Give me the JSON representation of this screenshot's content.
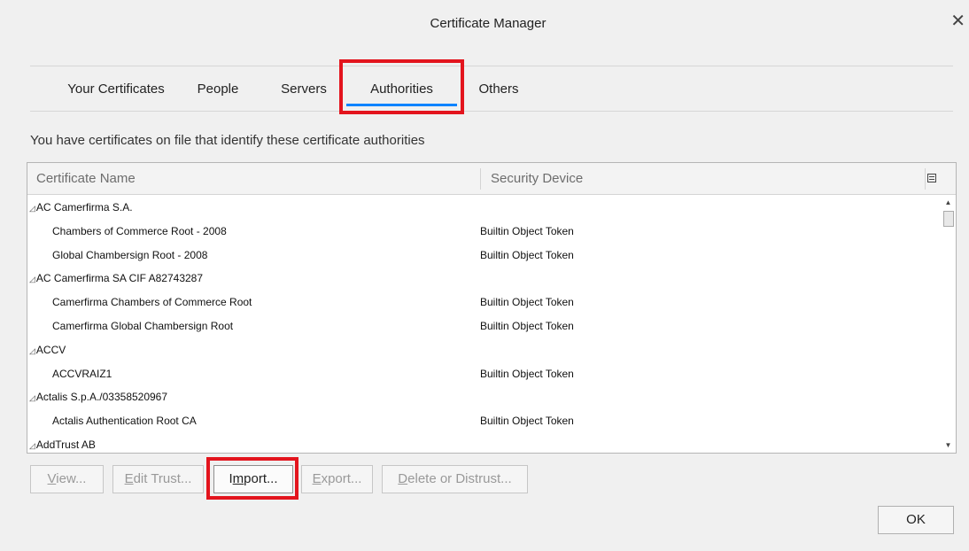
{
  "dialog": {
    "title": "Certificate Manager"
  },
  "tabs": [
    {
      "label": "Your Certificates",
      "selected": false
    },
    {
      "label": "People",
      "selected": false
    },
    {
      "label": "Servers",
      "selected": false
    },
    {
      "label": "Authorities",
      "selected": true
    },
    {
      "label": "Others",
      "selected": false
    }
  ],
  "description": "You have certificates on file that identify these certificate authorities",
  "table": {
    "columns": [
      "Certificate Name",
      "Security Device"
    ],
    "rows": [
      {
        "type": "group",
        "name": "AC Camerfirma S.A.",
        "device": ""
      },
      {
        "type": "child",
        "name": "Chambers of Commerce Root - 2008",
        "device": "Builtin Object Token"
      },
      {
        "type": "child",
        "name": "Global Chambersign Root - 2008",
        "device": "Builtin Object Token"
      },
      {
        "type": "group",
        "name": "AC Camerfirma SA CIF A82743287",
        "device": ""
      },
      {
        "type": "child",
        "name": "Camerfirma Chambers of Commerce Root",
        "device": "Builtin Object Token"
      },
      {
        "type": "child",
        "name": "Camerfirma Global Chambersign Root",
        "device": "Builtin Object Token"
      },
      {
        "type": "group",
        "name": "ACCV",
        "device": ""
      },
      {
        "type": "child",
        "name": "ACCVRAIZ1",
        "device": "Builtin Object Token"
      },
      {
        "type": "group",
        "name": "Actalis S.p.A./03358520967",
        "device": ""
      },
      {
        "type": "child",
        "name": "Actalis Authentication Root CA",
        "device": "Builtin Object Token"
      },
      {
        "type": "group",
        "name": "AddTrust AB",
        "device": ""
      }
    ]
  },
  "buttons": {
    "view": {
      "pre": "",
      "key": "V",
      "post": "iew..."
    },
    "edit_trust": {
      "pre": "",
      "key": "E",
      "post": "dit Trust..."
    },
    "import": {
      "pre": "I",
      "key": "m",
      "post": "port..."
    },
    "export": {
      "pre": "",
      "key": "E",
      "post": "xport..."
    },
    "delete": {
      "pre": "",
      "key": "D",
      "post": "elete or Distrust..."
    },
    "ok": "OK"
  },
  "icons": {
    "close": "close-icon",
    "twisty": "expanded-twisty-icon",
    "column_picker": "column-picker-icon"
  },
  "colors": {
    "highlight": "#e3141d",
    "tab_underline": "#0a84ff"
  }
}
